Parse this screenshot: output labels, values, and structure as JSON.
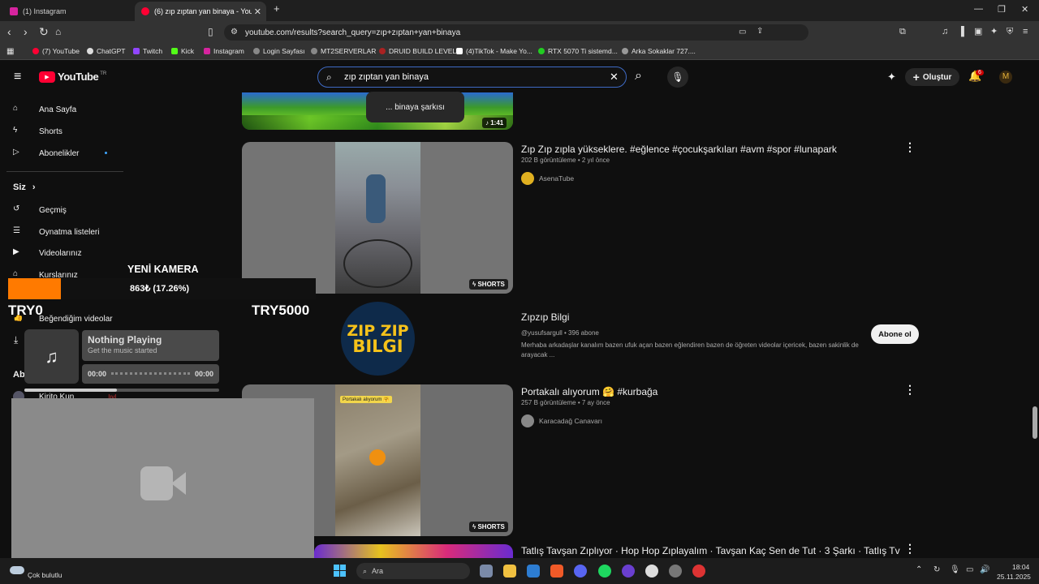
{
  "browser": {
    "tabs": [
      {
        "label": "(1) Instagram",
        "active": false
      },
      {
        "label": "(6) zıp zıptan yan binaya - YouTu",
        "active": true
      }
    ],
    "url": "youtube.com/results?search_query=zıp+zıptan+yan+binaya",
    "bookmarks": [
      "(7) YouTube",
      "ChatGPT",
      "Twitch",
      "Kick",
      "Instagram",
      "Login Sayfası",
      "MT2SERVERLAR",
      "DRUID BUILD LEVEL",
      "(4)TikTok - Make Yo...",
      "RTX 5070 Ti sistemd...",
      "Arka Sokaklar 727...."
    ]
  },
  "youtube": {
    "logo": "YouTube",
    "region": "TR",
    "search_value": "zıp zıptan yan binaya",
    "suggestion": "... binaya şarkısı",
    "create_label": "Oluştur",
    "notif_count": "6",
    "sidebar": {
      "items": [
        "Ana Sayfa",
        "Shorts",
        "Abonelikler"
      ],
      "you_heading": "Siz",
      "you_items": [
        "Geçmiş",
        "Oynatma listeleri",
        "Videolarınız",
        "Kurslarınız",
        "Beğendiğim videolar"
      ],
      "subs_heading": "Ab",
      "sub_channel": "Kirito Kun",
      "sub_live": "lıvl"
    },
    "results": [
      {
        "duration": "1:41"
      },
      {
        "title": "Zıp Zıp zıpla yükseklere. #eğlence #çocukşarkıları #avm #spor #lunapark",
        "meta": "202 B görüntüleme • 2 yıl önce",
        "channel": "AsenaTube",
        "badge": "SHORTS"
      },
      {
        "title": "Zıpzıp Bilgi",
        "meta": "@yusufsargull • 396 abone",
        "desc": "Merhaba arkadaşlar kanalım bazen ufuk açan bazen eğlendiren bazen de öğreten videolar içericek, bazen sakinlik de arayacak ...",
        "subscribe": "Abone ol",
        "logo_top": "ZIP ZIP",
        "logo_bottom": "BILGI"
      },
      {
        "title": "Portakalı alıyorum 🤗 #kurbağa",
        "meta": "257 B görüntüleme • 7 ay önce",
        "channel": "Karacadağ Canavarı",
        "badge": "SHORTS",
        "thumb_caption": "Portakalı alıyorum 🤗"
      },
      {
        "title": "Tatlış Tavşan Zıplıyor · Hop Hop Zıplayalım · Tavşan Kaç Sen de Tut · 3 Şarkı · Tatlış Tv"
      }
    ]
  },
  "donation": {
    "title": "YENİ KAMERA",
    "progress_text": "863₺ (17.26%)",
    "progress_fraction": 0.1726,
    "min": "TRY0",
    "max": "TRY5000"
  },
  "music": {
    "title": "Nothing Playing",
    "subtitle": "Get the music started",
    "time_start": "00:00",
    "time_end": "00:00"
  },
  "taskbar": {
    "weather": "Çok bulutlu",
    "search_placeholder": "Ara",
    "time": "18:04",
    "date": "25.11.2025"
  },
  "colors": {
    "accent_red": "#ff0033",
    "donation_orange": "#ff7a00",
    "search_border": "#3e6ac4"
  }
}
